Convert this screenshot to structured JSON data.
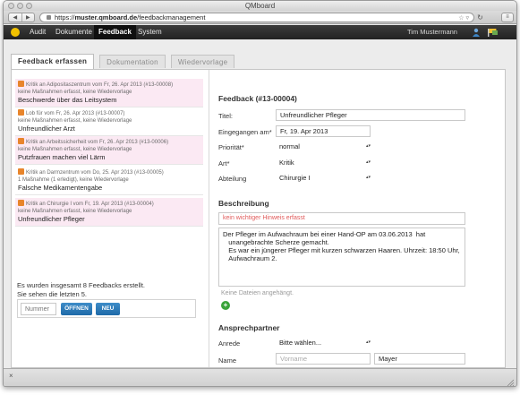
{
  "window": {
    "title": "QMboard"
  },
  "browser": {
    "url_prefix": "https://",
    "url_host": "muster.qmboard.de",
    "url_path": "/feedbackmanagement"
  },
  "nav": {
    "items": [
      "Audit",
      "Dokumente",
      "Feedback",
      "System"
    ],
    "active": "Feedback",
    "user_name": "Tim Mustermann"
  },
  "tabs": [
    {
      "label": "Feedback erfassen",
      "active": true
    },
    {
      "label": "Dokumentation",
      "active": false
    },
    {
      "label": "Wiedervorlage",
      "active": false
    }
  ],
  "feedback_list": [
    {
      "meta": "Kritik an Adipositaszentrum vom Fr, 26. Apr 2013 (#13-00008)",
      "status": "keine Maßnahmen erfasst, keine Wiedervorlage",
      "title": "Beschwerde über das Leitsystem"
    },
    {
      "meta": "Lob für vom Fr, 26. Apr 2013 (#13-00007)",
      "status": "keine Maßnahmen erfasst, keine Wiedervorlage",
      "title": "Unfreundlicher Arzt"
    },
    {
      "meta": "Kritik an Arbeitssicherheit vom Fr, 26. Apr 2013 (#13-00006)",
      "status": "keine Maßnahmen erfasst, keine Wiedervorlage",
      "title": "Putzfrauen machen viel Lärm"
    },
    {
      "meta": "Kritik an Darmzentrum vom Do, 25. Apr 2013 (#13-00005)",
      "status": "1 Maßnahme (1 erledigt), keine Wiedervorlage",
      "title": "Falsche Medikamentengabe"
    },
    {
      "meta": "Kritik an Chirurgie I vom Fr, 19. Apr 2013 (#13-00004)",
      "status": "keine Maßnahmen erfasst, keine Wiedervorlage",
      "title": "Unfreundlicher Pfleger"
    }
  ],
  "summary": {
    "line1": "Es wurden insgesamt 8 Feedbacks erstellt.",
    "line2": "Sie sehen die letzten 5."
  },
  "search": {
    "placeholder": "Nummer",
    "open_label": "ÖFFNEN",
    "new_label": "NEU"
  },
  "detail": {
    "heading": "Feedback (#13-00004)",
    "fields": {
      "titel": {
        "label": "Titel:",
        "value": "Unfreundlicher Pfleger"
      },
      "eingegangen": {
        "label": "Eingegangen am*",
        "value": "Fr, 19. Apr 2013"
      },
      "prioritaet": {
        "label": "Priorität*",
        "value": "normal"
      },
      "art": {
        "label": "Art*",
        "value": "Kritik"
      },
      "abteilung": {
        "label": "Abteilung",
        "value": "Chirurgie I"
      }
    },
    "beschreibung": {
      "heading": "Beschreibung",
      "warning": "kein wichtiger Hinweis erfasst",
      "text": "Der Pfleger im Aufwachraum bei einer Hand-OP am 03.06.2013  hat\n   unangebrachte Scherze gemacht.\n   Es war ein jüngerer Pfleger mit kurzen schwarzen Haaren. Uhrzeit: 18:50 Uhr,\n   Aufwachraum 2."
    },
    "files_note": "Keine Dateien angehängt.",
    "contact": {
      "heading": "Ansprechpartner",
      "anrede_label": "Anrede",
      "anrede_value": "Bitte wählen...",
      "name_label": "Name",
      "vorname_placeholder": "Vorname",
      "nachname_value": "Mayer"
    }
  },
  "colors": {
    "nav_bg": "#2b2b2b",
    "button_blue": "#2a78b8",
    "warning_red": "#e05a5a",
    "highlight_pink": "#fbe9f3",
    "feedback_icon": "#e8852c"
  }
}
